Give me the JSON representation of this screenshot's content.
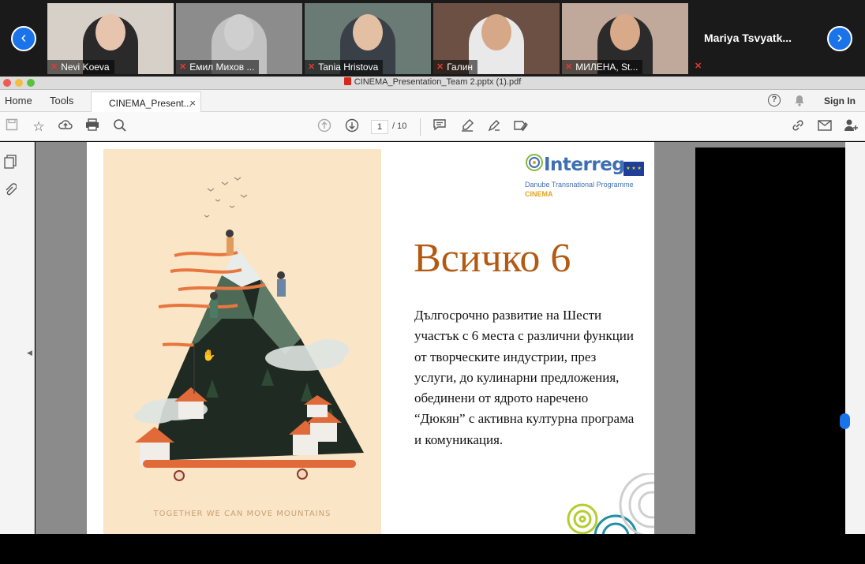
{
  "meeting": {
    "prev_label": "‹",
    "next_label": "›",
    "participants": [
      {
        "name": "Nevi Koeva",
        "muted": true,
        "bg": "#d7d0c8",
        "shirt": "#2a2a2a",
        "skin": "#e7c4ad"
      },
      {
        "name": "Емил Михов ...",
        "muted": true,
        "bg": "#8c8c8c",
        "shirt": "#c2c2c2",
        "skin": "#cfcfcf"
      },
      {
        "name": "Tania Hristova",
        "muted": true,
        "bg": "#6a7a74",
        "shirt": "#3a4048",
        "skin": "#e3c0a3"
      },
      {
        "name": "Галин",
        "muted": true,
        "bg": "#6b5043",
        "shirt": "#e9e9e9",
        "skin": "#d6a888"
      },
      {
        "name": "МИЛЕНА, St...",
        "muted": true,
        "bg": "#c0a99a",
        "shirt": "#2b2b2b",
        "skin": "#d9aa8a"
      }
    ],
    "named_only": {
      "name": "Mariya  Tsvyatk...",
      "muted": true
    }
  },
  "window": {
    "title": "CINEMA_Presentation_Team 2.pptx (1).pdf"
  },
  "menubar": {
    "home": "Home",
    "tools": "Tools",
    "tab_label": "CINEMA_Present...",
    "tab_close": "×",
    "help": "?",
    "sign_in": "Sign In"
  },
  "toolbar": {
    "current_page": "1",
    "page_total": "/ 10"
  },
  "slide": {
    "title": "Всичко 6",
    "body": "Дългосрочно развитие на Шести участък с 6 места с различни функции от творческите индустрии, през услуги, до кулинарни предложения, обединени от ядрото наречено “Дюкян” с активна културна програма и комуникация.",
    "poster_caption": "TOGETHER WE CAN MOVE MOUNTAINS",
    "logo_name": "Interreg",
    "logo_sub": "Danube Transnational Programme",
    "logo_project": "CINEMA",
    "title_color": "#b35a12"
  }
}
